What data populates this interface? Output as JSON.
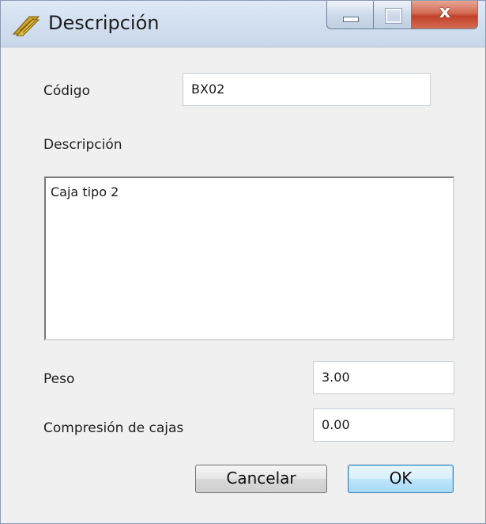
{
  "window": {
    "title": "Descripción",
    "icon": "ruler-stack-icon",
    "controls": {
      "minimize": "minimize-icon",
      "maximize": "maximize-icon",
      "close_glyph": "x"
    }
  },
  "form": {
    "code": {
      "label": "Código",
      "value": "BX02"
    },
    "description": {
      "label": "Descripción",
      "value": "Caja tipo 2"
    },
    "weight": {
      "label": "Peso",
      "value": "3.00"
    },
    "compression": {
      "label": "Compresión de cajas",
      "value": "0.00"
    }
  },
  "buttons": {
    "cancel": "Cancelar",
    "ok": "OK"
  },
  "colors": {
    "window_bg": "#f0f0f0",
    "titlebar": "#d3e0f0",
    "close_button": "#c0422a",
    "ok_button": "#bee6fd"
  }
}
